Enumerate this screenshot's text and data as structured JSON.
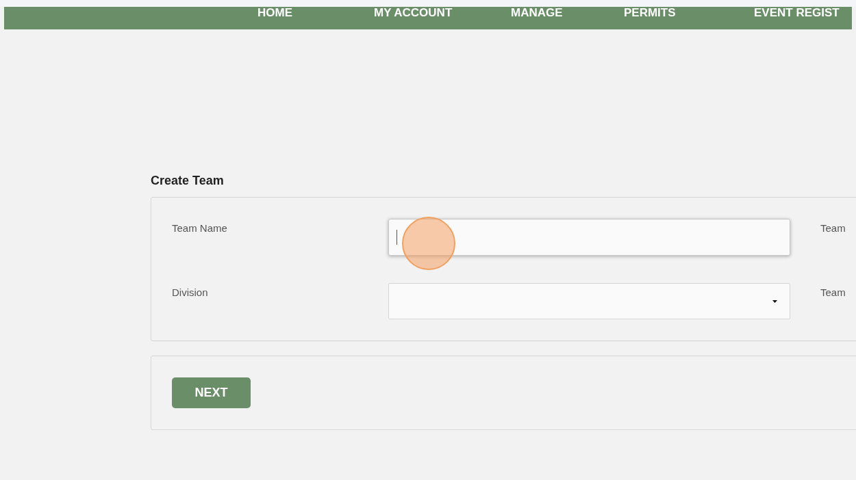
{
  "nav": {
    "items": [
      "HOME",
      "MY ACCOUNT",
      "MANAGE",
      "PERMITS",
      "EVENT REGIST"
    ]
  },
  "form": {
    "title": "Create Team",
    "rows": [
      {
        "kind": "text",
        "label": "Team Name",
        "focused": true,
        "side_label": "Team"
      },
      {
        "kind": "select",
        "label": "Division",
        "focused": false,
        "side_label": "Team"
      }
    ]
  },
  "actions": {
    "button": "NEXT"
  },
  "click_marker": true
}
